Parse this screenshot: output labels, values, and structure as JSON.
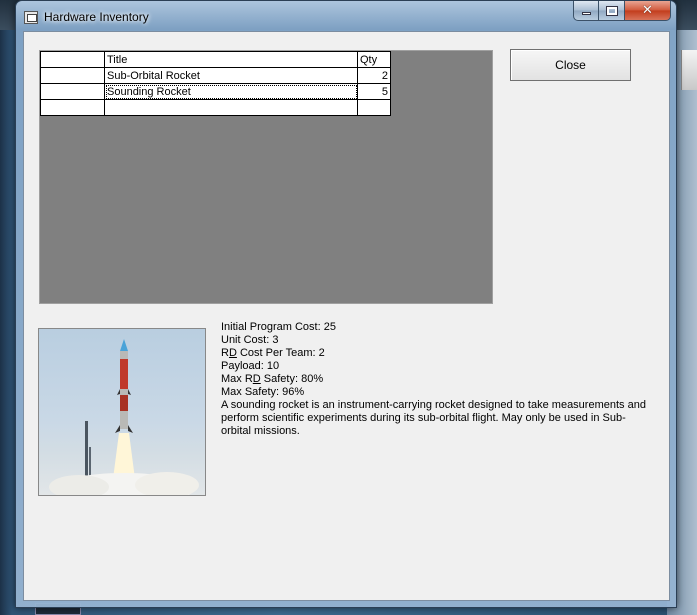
{
  "window": {
    "title": "Hardware Inventory"
  },
  "grid": {
    "columns": [
      "Title",
      "Qty"
    ],
    "rows": [
      {
        "title": "Sub-Orbital Rocket",
        "qty": "2"
      },
      {
        "title": "Sounding Rocket",
        "qty": "5"
      }
    ]
  },
  "buttons": {
    "close_label": "Close"
  },
  "details": {
    "initial_program_cost": "Initial Program Cost: 25",
    "unit_cost": "Unit Cost: 3",
    "rd_cost_prefix": "R",
    "rd_cost_underlined": "D",
    "rd_cost_rest": " Cost Per Team: 2",
    "payload": "Payload: 10",
    "max_rd_prefix": "Max R",
    "max_rd_underlined": "D",
    "max_rd_rest": " Safety: 80%",
    "max_safety": "Max Safety: 96%",
    "description": "A sounding rocket is an instrument-carrying rocket designed to take measurements and perform scientific experiments during its sub-orbital flight. May only be used in Sub-orbital missions."
  },
  "image": {
    "subject": "sounding-rocket-launch-photo"
  }
}
